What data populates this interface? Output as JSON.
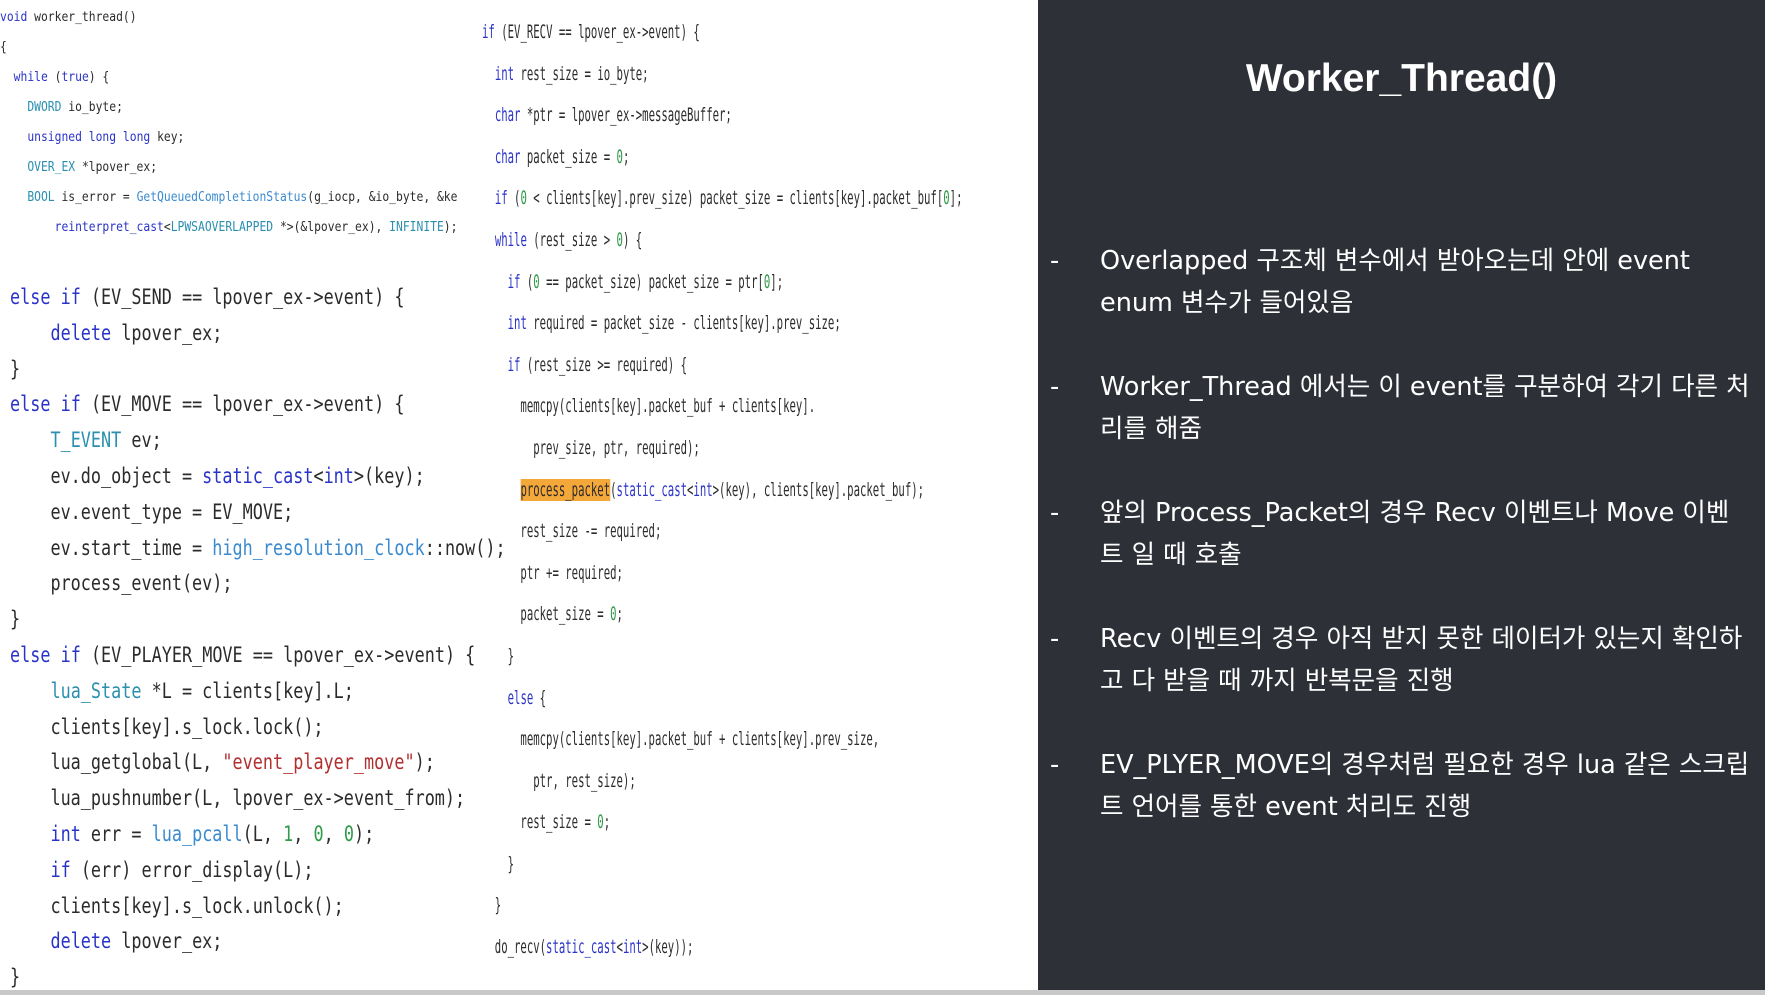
{
  "title": "Worker_Thread()",
  "code_block_1": [
    "void worker_thread()",
    "{",
    "  while (true) {",
    "    DWORD io_byte;",
    "    unsigned long long key;",
    "    OVER_EX *lpover_ex;",
    "    BOOL is_error = GetQueuedCompletionStatus(g_iocp, &io_byte, &ke",
    "        reinterpret_cast<LPWSAOVERLAPPED *>(&lpover_ex), INFINITE);"
  ],
  "code_block_2": [
    "else if (EV_SEND == lpover_ex->event) {",
    "    delete lpover_ex;",
    "}",
    "else if (EV_MOVE == lpover_ex->event) {",
    "    T_EVENT ev;",
    "    ev.do_object = static_cast<int>(key);",
    "    ev.event_type = EV_MOVE;",
    "    ev.start_time = high_resolution_clock::now();",
    "    process_event(ev);",
    "}",
    "else if (EV_PLAYER_MOVE == lpover_ex->event) {",
    "    lua_State *L = clients[key].L;",
    "    clients[key].s_lock.lock();",
    "    lua_getglobal(L, \"event_player_move\");",
    "    lua_pushnumber(L, lpover_ex->event_from);",
    "    int err = lua_pcall(L, 1, 0, 0);",
    "    if (err) error_display(L);",
    "    clients[key].s_lock.unlock();",
    "    delete lpover_ex;",
    "}"
  ],
  "code_block_3": [
    "if (EV_RECV == lpover_ex->event) {",
    "  int rest_size = io_byte;",
    "  char *ptr = lpover_ex->messageBuffer;",
    "  char packet_size = 0;",
    "  if (0 < clients[key].prev_size) packet_size = clients[key].packet_buf[0];",
    "  while (rest_size > 0) {",
    "    if (0 == packet_size) packet_size = ptr[0];",
    "    int required = packet_size - clients[key].prev_size;",
    "    if (rest_size >= required) {",
    "      memcpy(clients[key].packet_buf + clients[key].",
    "        prev_size, ptr, required);",
    "      process_packet(static_cast<int>(key), clients[key].packet_buf);",
    "      rest_size -= required;",
    "      ptr += required;",
    "      packet_size = 0;",
    "    }",
    "    else {",
    "      memcpy(clients[key].packet_buf + clients[key].prev_size,",
    "        ptr, rest_size);",
    "      rest_size = 0;",
    "    }",
    "  }",
    "  do_recv(static_cast<int>(key));"
  ],
  "bullets": [
    {
      "marker": "-",
      "text": "Overlapped 구조체 변수에서 받아오는데 안에 event enum 변수가 들어있음"
    },
    {
      "marker": "-",
      "text": "Worker_Thread 에서는 이 event를 구분하여 각기 다른 처리를 해줌"
    },
    {
      "marker": "-",
      "text": "앞의 Process_Packet의 경우 Recv 이벤트나 Move 이벤트 일 때 호출"
    },
    {
      "marker": "-",
      "text": "Recv 이벤트의 경우 아직 받지 못한 데이터가 있는지 확인하고 다 받을 때 까지 반복문을 진행"
    },
    {
      "marker": "-",
      "text": "EV_PLYER_MOVE의 경우처럼 필요한 경우 lua 같은 스크립트 언어를 통한 event 처리도 진행"
    }
  ],
  "colors": {
    "panel_background": "#2e3038",
    "highlight": "#f5a83a",
    "keyword": "#2a33c8",
    "string": "#b23030"
  }
}
